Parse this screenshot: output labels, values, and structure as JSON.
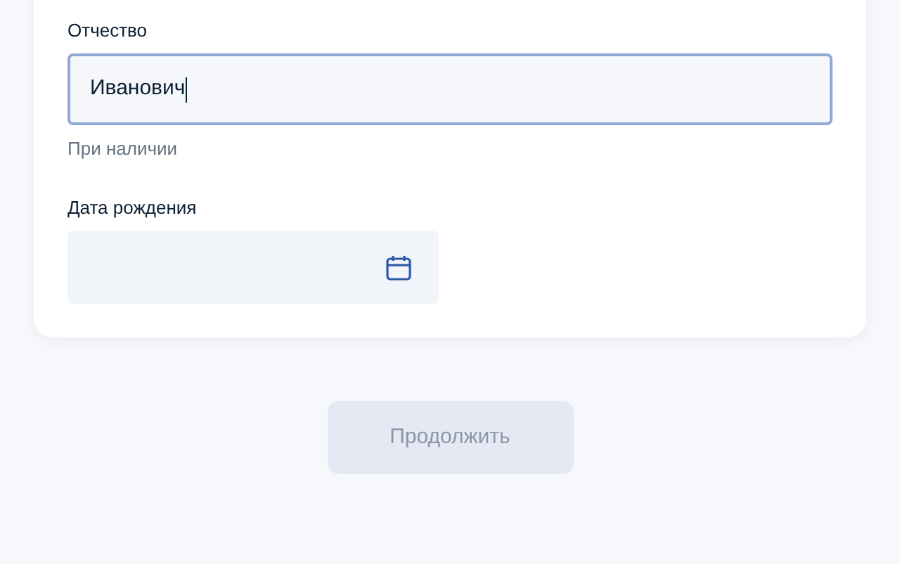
{
  "fields": [
    {
      "kind": "text",
      "label": "Отчество",
      "value": "Иванович",
      "focused": true,
      "hint": "При наличии"
    },
    {
      "kind": "date",
      "label": "Дата рождения",
      "focused": false
    }
  ],
  "continue_button": {
    "label": "Продолжить",
    "disabled": true
  }
}
